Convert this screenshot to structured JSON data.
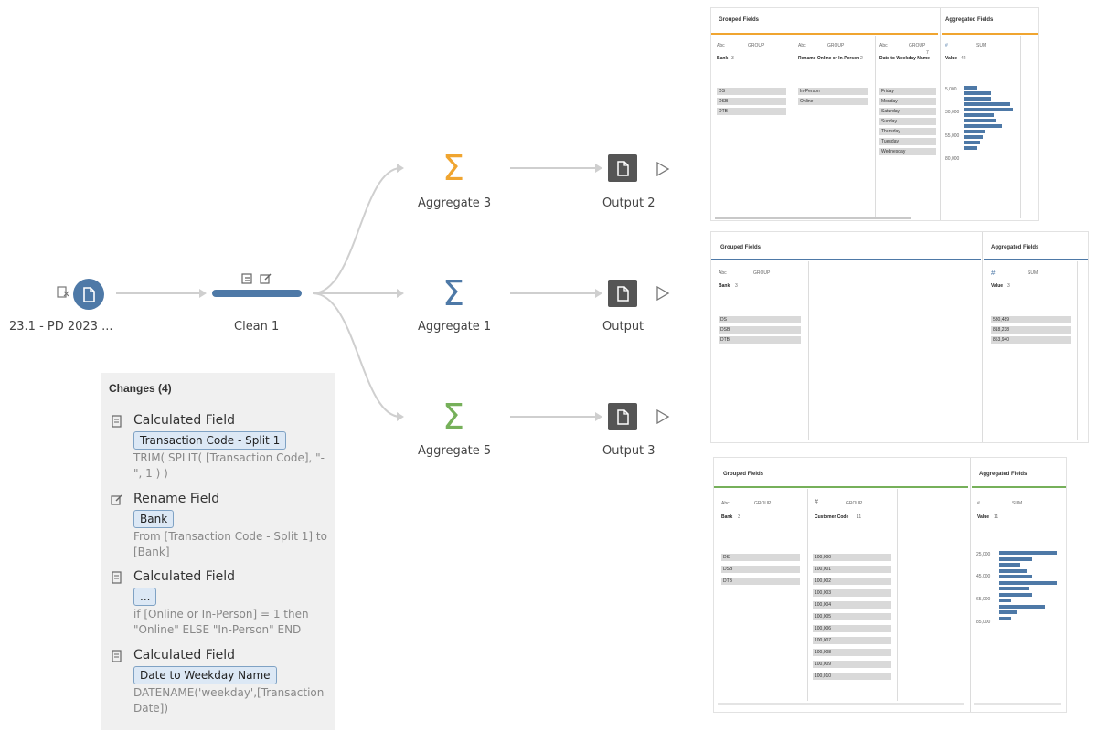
{
  "flow": {
    "input": {
      "label": "23.1 - PD 2023 ..."
    },
    "clean": {
      "label": "Clean 1"
    },
    "aggregates": [
      {
        "label": "Aggregate 3",
        "color": "#f0a530"
      },
      {
        "label": "Aggregate 1",
        "color": "#4e79a7"
      },
      {
        "label": "Aggregate 5",
        "color": "#76b05a"
      }
    ],
    "outputs": [
      {
        "label": "Output 2"
      },
      {
        "label": "Output"
      },
      {
        "label": "Output 3"
      }
    ]
  },
  "changes": {
    "title": "Changes (4)",
    "items": [
      {
        "type": "Calculated Field",
        "field": "Transaction Code - Split 1",
        "desc": "TRIM( SPLIT( [Transaction Code], \"-\", 1 ) )"
      },
      {
        "type": "Rename Field",
        "field": "Bank",
        "desc": "From [Transaction Code - Split 1] to [Bank]"
      },
      {
        "type": "Calculated Field",
        "field": "...",
        "desc": "if [Online or In-Person] = 1 then \"Online\" ELSE \"In-Person\" END"
      },
      {
        "type": "Calculated Field",
        "field": "Date to Weekday Name",
        "desc": "DATENAME('weekday',[Transaction Date])"
      }
    ]
  },
  "panel1": {
    "grouped_title": "Grouped Fields",
    "aggregated_title": "Aggregated Fields",
    "accent": "#f0a530",
    "cols": [
      {
        "type": "Abc",
        "role": "GROUP",
        "name": "Bank",
        "count": "3",
        "values": [
          "DS",
          "DSB",
          "DTB"
        ]
      },
      {
        "type": "Abc",
        "role": "GROUP",
        "name": "Rename Online or In-Person",
        "count": "2",
        "values": [
          "In-Person",
          "Online"
        ]
      },
      {
        "type": "Abc",
        "role": "GROUP",
        "name": "Date to Weekday Name",
        "count": "7",
        "values": [
          "Friday",
          "Monday",
          "Saturday",
          "Sunday",
          "Thursday",
          "Tuesday",
          "Wednesday"
        ]
      }
    ],
    "agg": {
      "type": "#",
      "role": "SUM",
      "name": "Value",
      "count": "42",
      "ticks": [
        "5,000",
        "30,000",
        "55,000",
        "80,000"
      ],
      "bars": [
        0.25,
        0.5,
        0.5,
        0.85,
        0.9,
        0.55,
        0.6,
        0.7,
        0.4,
        0.35,
        0.3,
        0.25
      ]
    }
  },
  "panel2": {
    "grouped_title": "Grouped Fields",
    "aggregated_title": "Aggregated Fields",
    "accent": "#4e79a7",
    "cols": [
      {
        "type": "Abc",
        "role": "GROUP",
        "name": "Bank",
        "count": "3",
        "values": [
          "DS",
          "DSB",
          "DTB"
        ]
      }
    ],
    "agg": {
      "type": "#",
      "role": "SUM",
      "name": "Value",
      "count": "3",
      "values": [
        "530,489",
        "818,238",
        "853,940"
      ]
    }
  },
  "panel3": {
    "grouped_title": "Grouped Fields",
    "aggregated_title": "Aggregated Fields",
    "accent": "#76b05a",
    "cols": [
      {
        "type": "Abc",
        "role": "GROUP",
        "name": "Bank",
        "count": "3",
        "values": [
          "DS",
          "DSB",
          "DTB"
        ]
      },
      {
        "type": "#",
        "role": "GROUP",
        "name": "Customer Code",
        "count": "11",
        "values": [
          "100,000",
          "100,001",
          "100,002",
          "100,003",
          "100,004",
          "100,005",
          "100,006",
          "100,007",
          "100,008",
          "100,009",
          "100,010"
        ]
      }
    ],
    "agg": {
      "type": "#",
      "role": "SUM",
      "name": "Value",
      "count": "11",
      "ticks": [
        "25,000",
        "45,000",
        "65,000",
        "85,000"
      ],
      "bars": [
        0.95,
        0.55,
        0.35,
        0.45,
        0.55,
        0.95,
        0.5,
        0.55,
        0.2,
        0.75,
        0.3,
        0.2
      ]
    }
  }
}
